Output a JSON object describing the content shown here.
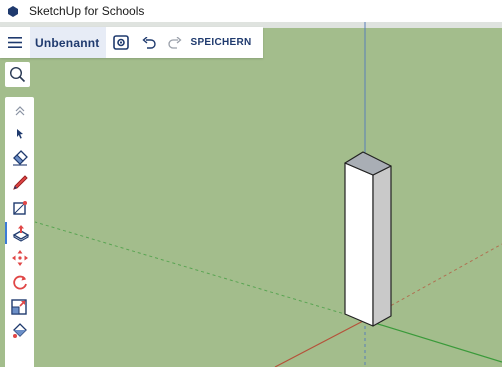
{
  "window": {
    "title": "SketchUp for Schools",
    "app_icon": "sketchup-logo-icon"
  },
  "toolbar": {
    "menu_icon": "hamburger-menu-icon",
    "document_name": "Unbenannt",
    "instructor_icon": "instructor-panel-icon",
    "undo_icon": "undo-icon",
    "redo_icon": "redo-icon",
    "save_label": "SPEICHERN"
  },
  "tools": {
    "search_icon": "search-icon",
    "collapse_icon": "collapse-chevron-icon",
    "items": [
      {
        "name": "select-tool",
        "icon": "arrow-cursor-icon",
        "active": false
      },
      {
        "name": "eraser-tool",
        "icon": "eraser-icon",
        "active": false
      },
      {
        "name": "line-tool",
        "icon": "pencil-icon",
        "active": false
      },
      {
        "name": "rectangle-tool",
        "icon": "rectangle-icon",
        "active": false
      },
      {
        "name": "push-pull-tool",
        "icon": "push-pull-icon",
        "active": true
      },
      {
        "name": "move-tool",
        "icon": "move-arrows-icon",
        "active": false
      },
      {
        "name": "rotate-tool",
        "icon": "rotate-icon",
        "active": false
      },
      {
        "name": "scale-tool",
        "icon": "scale-icon",
        "active": false
      },
      {
        "name": "paint-tool",
        "icon": "paint-bucket-icon",
        "active": false
      }
    ]
  },
  "colors": {
    "ground": "#a3bd8c",
    "sky": "#dfe3df",
    "blue_axis": "#5a7fb8",
    "red_axis": "#b5523a",
    "green_axis": "#3a9a3a",
    "accent": "#1f3a6e",
    "active_tool": "#3b7bd6"
  }
}
